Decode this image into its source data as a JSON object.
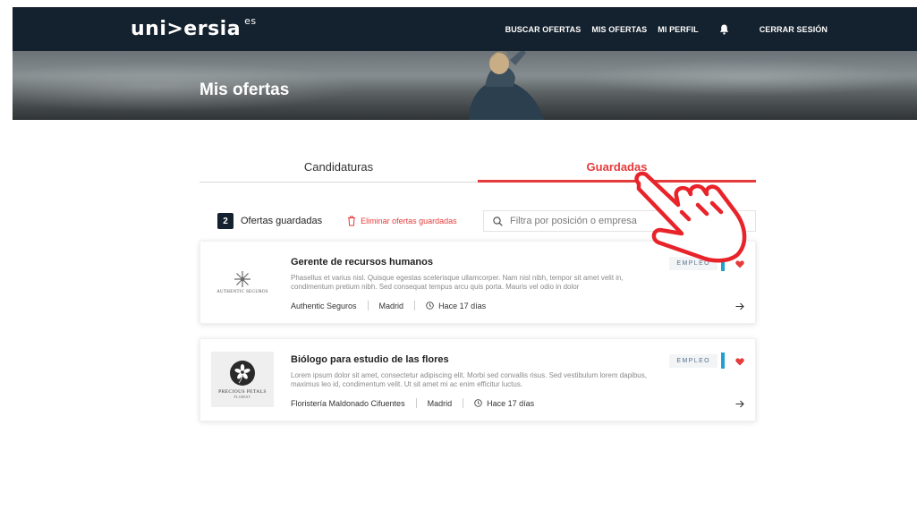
{
  "header": {
    "logo": "uni>ersia",
    "logo_suffix": "es",
    "nav": [
      "BUSCAR OFERTAS",
      "MIS OFERTAS",
      "MI PERFIL"
    ],
    "logout": "CERRAR SESIÓN"
  },
  "hero": {
    "title": "Mis ofertas"
  },
  "tabs": [
    {
      "label": "Candidaturas",
      "active": false
    },
    {
      "label": "Guardadas",
      "active": true
    }
  ],
  "toolbar": {
    "count": "2",
    "count_label": "Ofertas guardadas",
    "delete_label": "Eliminar ofertas guardadas",
    "search_placeholder": "Filtra por posición o empresa"
  },
  "offers": [
    {
      "title": "Gerente de recursos humanos",
      "description": "Phasellus et varius nisl. Quisque egestas scelerisque ullamcorper. Nam nisl nibh, tempor sit amet velit in, condimentum pretium nibh. Sed consequat tempus arcu quis porta. Mauris vel odio in dolor",
      "company": "Authentic Seguros",
      "company_logo_text": "AUTHENTIC SEGUROS",
      "location": "Madrid",
      "time": "Hace 17 días",
      "tag": "EMPLEO"
    },
    {
      "title": "Biólogo para estudio de las flores",
      "description": "Lorem ipsum dolor sit amet, consectetur adipiscing elit. Morbi sed convallis risus. Sed vestibulum lorem dapibus, maximus leo id, condimentum velit. Ut sit amet mi ac enim efficitur luctus.",
      "company": "Floristería Maldonado Cifuentes",
      "company_logo_text": "PRECIOUS PETALS",
      "company_logo_subtext": "FLORIST",
      "location": "Madrid",
      "time": "Hace 17 días",
      "tag": "EMPLEO"
    }
  ],
  "colors": {
    "navbar": "#14212e",
    "accent_red": "#e53b3b",
    "tag_blue": "#1ea0d0"
  },
  "icons": [
    "bell-icon",
    "trash-icon",
    "search-icon",
    "heart-icon",
    "clock-icon",
    "arrow-right-icon",
    "hand-pointer-icon"
  ]
}
